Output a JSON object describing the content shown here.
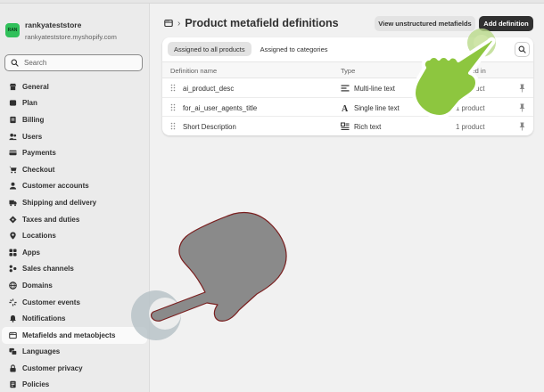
{
  "store": {
    "logo_text": "RAN",
    "name": "rankyateststore",
    "url": "rankyateststore.myshopify.com"
  },
  "search": {
    "placeholder": "Search"
  },
  "sidebar": {
    "items": [
      {
        "label": "General",
        "icon": "store-icon"
      },
      {
        "label": "Plan",
        "icon": "plan-icon"
      },
      {
        "label": "Billing",
        "icon": "billing-icon"
      },
      {
        "label": "Users",
        "icon": "users-icon"
      },
      {
        "label": "Payments",
        "icon": "payments-icon"
      },
      {
        "label": "Checkout",
        "icon": "cart-icon"
      },
      {
        "label": "Customer accounts",
        "icon": "person-icon"
      },
      {
        "label": "Shipping and delivery",
        "icon": "truck-icon"
      },
      {
        "label": "Taxes and duties",
        "icon": "tax-icon"
      },
      {
        "label": "Locations",
        "icon": "location-icon"
      },
      {
        "label": "Apps",
        "icon": "apps-icon"
      },
      {
        "label": "Sales channels",
        "icon": "channels-icon"
      },
      {
        "label": "Domains",
        "icon": "globe-icon"
      },
      {
        "label": "Customer events",
        "icon": "events-icon"
      },
      {
        "label": "Notifications",
        "icon": "bell-icon"
      },
      {
        "label": "Metafields and metaobjects",
        "icon": "metafields-icon",
        "active": true
      },
      {
        "label": "Languages",
        "icon": "languages-icon"
      },
      {
        "label": "Customer privacy",
        "icon": "lock-icon"
      },
      {
        "label": "Policies",
        "icon": "policy-icon"
      }
    ]
  },
  "header": {
    "title": "Product metafield definitions",
    "view_unstructured_label": "View unstructured metafields",
    "add_definition_label": "Add definition"
  },
  "tabs": [
    {
      "label": "Assigned to all products",
      "active": true
    },
    {
      "label": "Assigned to categories",
      "active": false
    }
  ],
  "table": {
    "columns": {
      "name": "Definition name",
      "type": "Type",
      "assigned": "Assigned in"
    },
    "rows": [
      {
        "name": "ai_product_desc",
        "type": "Multi-line text",
        "type_icon": "multiline-text-icon",
        "count": "1 product"
      },
      {
        "name": "for_ai_user_agents_title",
        "type": "Single line text",
        "type_icon": "single-line-text-icon",
        "count": "1 product"
      },
      {
        "name": "Short Description",
        "type": "Rich text",
        "type_icon": "rich-text-icon",
        "count": "1 product"
      }
    ]
  },
  "colors": {
    "accent_hand": "#8dc63f",
    "gray_hand": "#8a8a8a",
    "click_ring": "#b9c3c8"
  }
}
